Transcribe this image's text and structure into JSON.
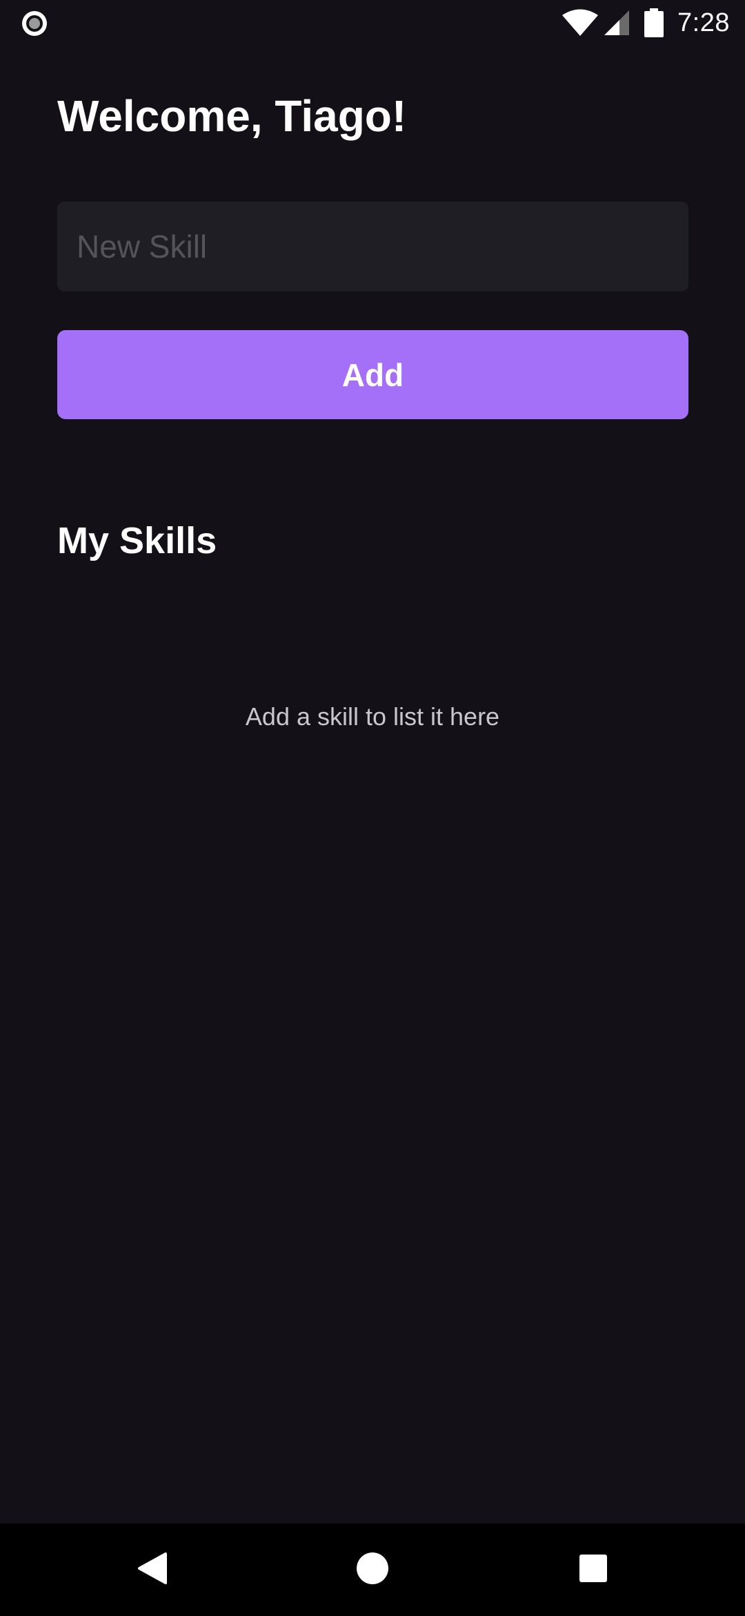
{
  "status_bar": {
    "time": "7:28",
    "icons": [
      "record-indicator-icon",
      "wifi-icon",
      "cellular-signal-icon",
      "battery-icon"
    ]
  },
  "main": {
    "welcome": "Welcome, Tiago!",
    "input": {
      "placeholder": "New Skill",
      "value": ""
    },
    "add_button_label": "Add",
    "section_title": "My Skills",
    "empty_message": "Add a skill to list it here"
  },
  "navigation_bar": {
    "icons": [
      "back-icon",
      "home-icon",
      "recents-icon"
    ]
  },
  "colors": {
    "background": "#131117",
    "input_background": "#1e1e24",
    "accent": "#a370f7",
    "placeholder": "#55545b",
    "muted_text": "#c8c8cc",
    "nav_background": "#000000"
  }
}
